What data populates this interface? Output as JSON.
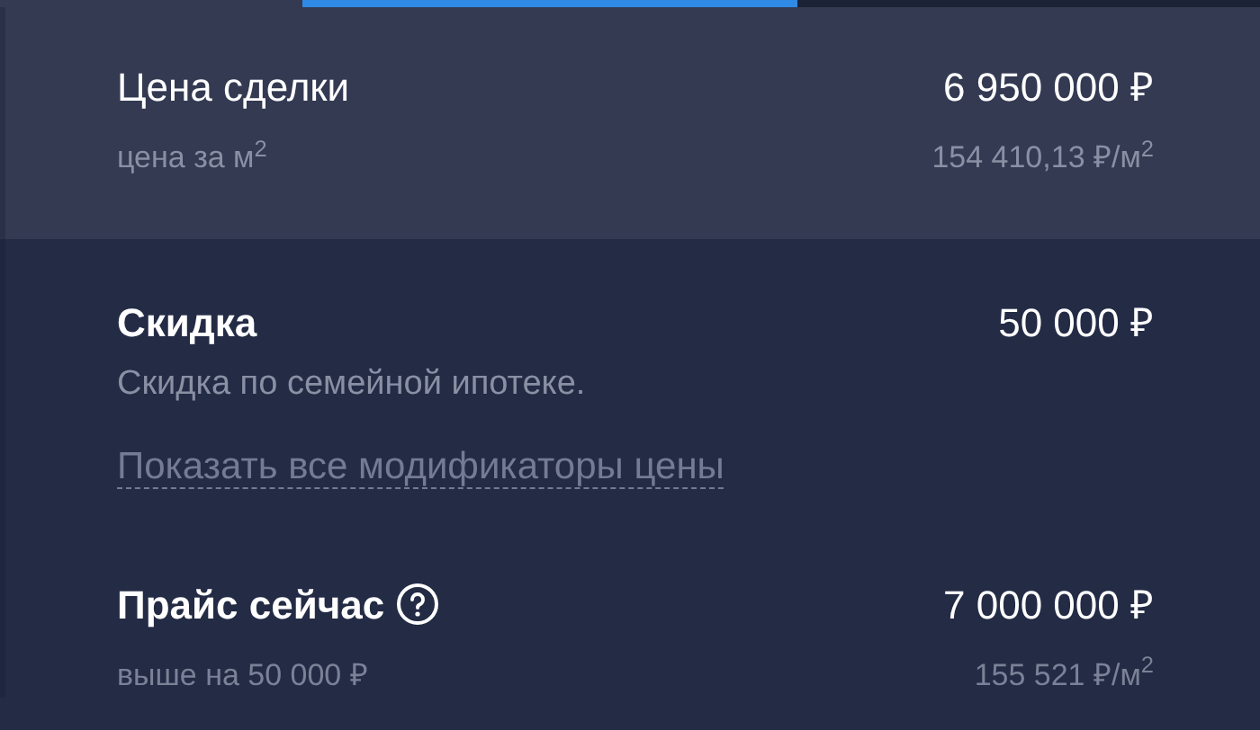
{
  "tabs": [
    {
      "selected": false
    },
    {
      "selected": true
    },
    {
      "selected": false
    }
  ],
  "deal": {
    "title": "Цена сделки",
    "price": "6 950 000 ₽",
    "per_label": "цена за м$^{2}$",
    "per_value": "154 410,13 ₽/м$^{2}$"
  },
  "discount": {
    "title": "Скидка",
    "amount": "50 000 ₽",
    "description": "Скидка по семейной ипотеке.",
    "link": "Показать все модификаторы цены"
  },
  "current": {
    "title": "Прайс сейчас",
    "price": "7 000 000 ₽",
    "difference": "выше на 50 000 ₽",
    "per_value": "155 521 ₽/м$^{2}$"
  }
}
